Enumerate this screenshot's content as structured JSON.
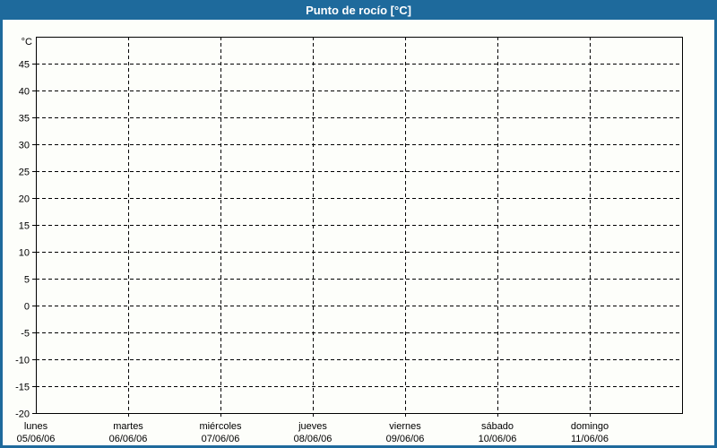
{
  "header": {
    "title": "Punto de rocío [°C]"
  },
  "colors": {
    "frame_blue": "#1e6a9c",
    "title_text": "#ffffff",
    "background": "#fdfefa",
    "grid_line": "#000000",
    "label_text": "#000000"
  },
  "chart_data": {
    "type": "line",
    "title": "Punto de rocío [°C]",
    "subtitle": "",
    "legend": "none",
    "grid": "dashed",
    "y_axis": {
      "unit": "°C",
      "min": -20,
      "max": 50,
      "tick_step": 5,
      "ticks": [
        45,
        40,
        35,
        30,
        25,
        20,
        15,
        10,
        5,
        0,
        -5,
        -10,
        -15,
        -20
      ]
    },
    "x_axis": {
      "categories": [
        {
          "day": "lunes",
          "date": "05/06/06"
        },
        {
          "day": "martes",
          "date": "06/06/06"
        },
        {
          "day": "miércoles",
          "date": "07/06/06"
        },
        {
          "day": "jueves",
          "date": "08/06/06"
        },
        {
          "day": "viernes",
          "date": "09/06/06"
        },
        {
          "day": "sábado",
          "date": "10/06/06"
        },
        {
          "day": "domingo",
          "date": "11/06/06"
        }
      ]
    },
    "series": []
  }
}
